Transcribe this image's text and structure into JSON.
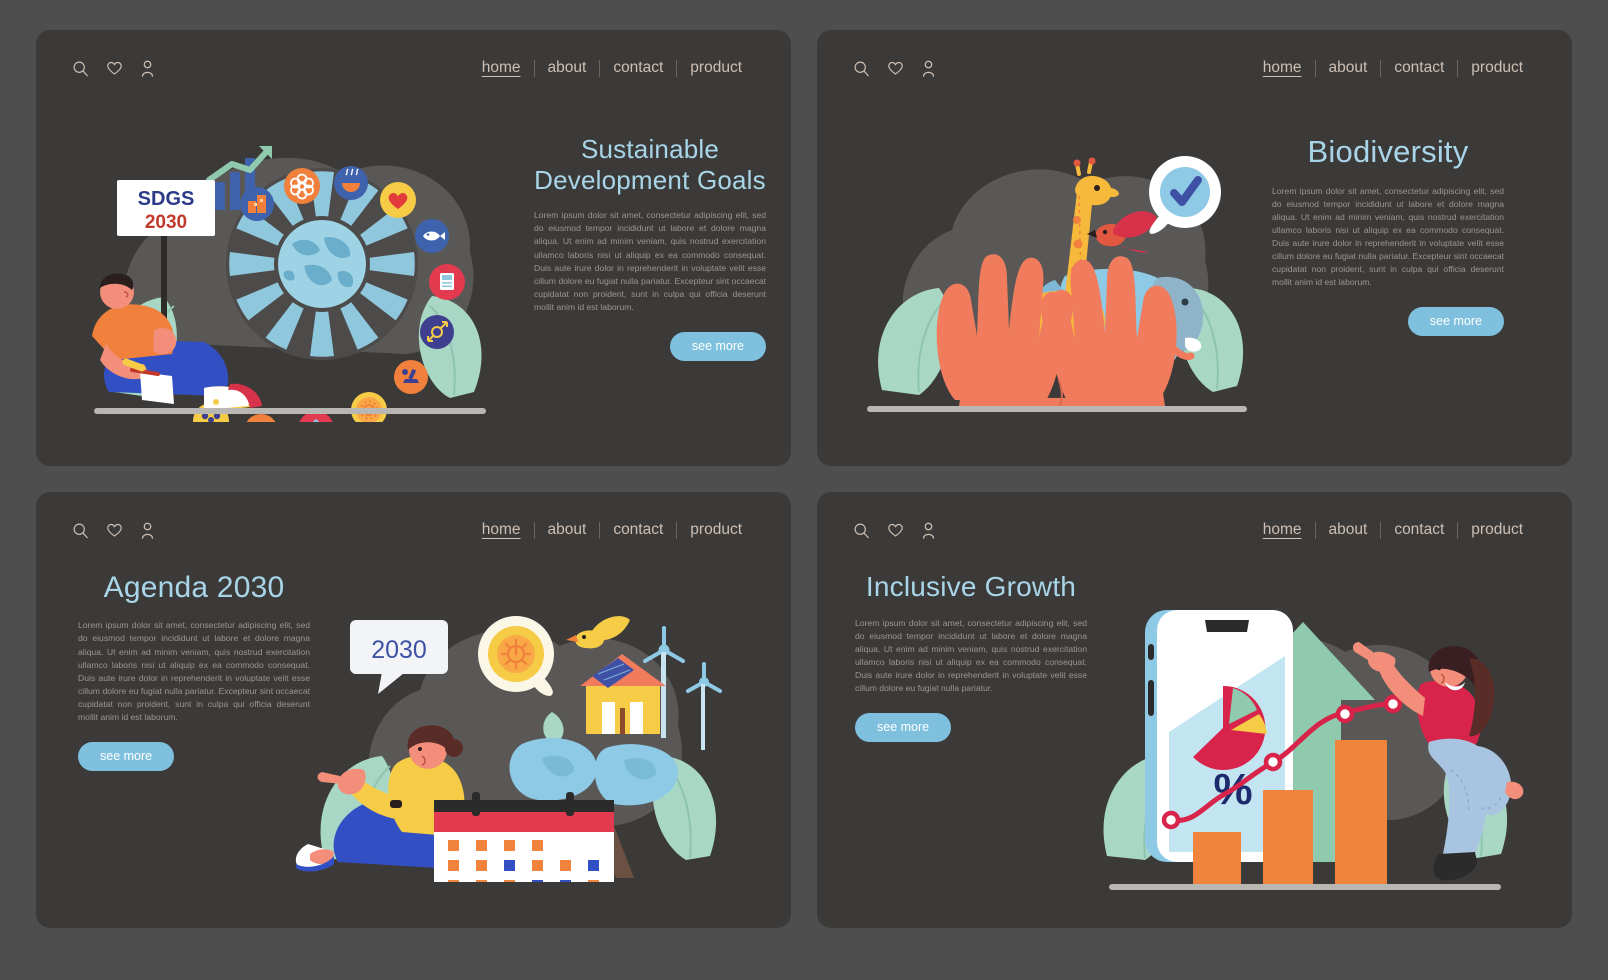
{
  "theme": {
    "page_bg": "#4e4e4e",
    "card_bg": "#3c3a39",
    "title_color": "#a8d6e8",
    "body_color": "#9d958e",
    "nav_color": "#cdbfb3",
    "button_bg": "#7fc0de",
    "button_text": "#ffffff"
  },
  "nav": {
    "icons": [
      {
        "name": "search-icon"
      },
      {
        "name": "heart-icon"
      },
      {
        "name": "user-icon"
      }
    ],
    "links": [
      {
        "label": "home",
        "active": true
      },
      {
        "label": "about",
        "active": false
      },
      {
        "label": "contact",
        "active": false
      },
      {
        "label": "product",
        "active": false
      }
    ]
  },
  "common": {
    "see_more": "see more",
    "lorem_long": "Lorem ipsum dolor sit amet, consectetur adipiscing elit, sed do eiusmod tempor incididunt ut labore et dolore magna aliqua. Ut enim ad minim veniam, quis nostrud exercitation ullamco laboris nisi ut aliquip ex ea commodo consequat. Duis aute irure dolor in reprehenderit in voluptate velit esse cillum dolore eu fugiat nulla pariatur. Excepteur sint occaecat cupidatat non proident, sunt in culpa qui officia deserunt mollit anim id est laborum.",
    "lorem_short": "Lorem ipsum dolor sit amet, consectetur adipiscing elit, sed do eiusmod tempor incididunt ut labore et dolore magna aliqua. Ut enim ad minim veniam, quis nostrud exercitation ullamco laboris nisi ut aliquip ex ea commodo consequat. Duis aute irure dolor in reprehenderit in voluptate velit esse cillum dolore eu fugiat nulla pariatur."
  },
  "cards": [
    {
      "id": "sustainable-development-goals",
      "title": "Sustainable Development Goals",
      "sign_top": "SDGS",
      "sign_bottom": "2030",
      "illustration": "sdg-wheel-person-sign",
      "icons": [
        {
          "name": "city-house-icon",
          "bg": "#3f62ad",
          "fg": "#f0803c"
        },
        {
          "name": "flower-partnership-icon",
          "bg": "#f0803c",
          "fg": "#ffffff"
        },
        {
          "name": "food-bowl-icon",
          "bg": "#3f62ad",
          "fg": "#f0803c"
        },
        {
          "name": "health-heart-icon",
          "bg": "#f6cc46",
          "fg": "#e23b3b"
        },
        {
          "name": "fish-life-below-water-icon",
          "bg": "#3f62ad",
          "fg": "#ffffff"
        },
        {
          "name": "education-book-icon",
          "bg": "#e23b4f",
          "fg": "#8fc7dd"
        },
        {
          "name": "gender-equality-icon",
          "bg": "#3f3f8f",
          "fg": "#f6cc46"
        },
        {
          "name": "industry-innovation-icon",
          "bg": "#f0803c",
          "fg": "#3f3f8f"
        },
        {
          "name": "clean-energy-sun-icon",
          "bg": "#f6cc46",
          "fg": "#f0803c"
        },
        {
          "name": "life-on-land-tree-icon",
          "bg": "#e23b4f",
          "fg": "#8fc7dd"
        },
        {
          "name": "clean-water-drop-icon",
          "bg": "#f0803c",
          "fg": "#ffffff"
        },
        {
          "name": "reduced-inequalities-people-icon",
          "bg": "#f6cc46",
          "fg": "#3f3f8f"
        }
      ]
    },
    {
      "id": "biodiversity",
      "title": "Biodiversity",
      "illustration": "hands-holding-animals",
      "elements": [
        {
          "name": "giraffe",
          "color": "#f6b93b"
        },
        {
          "name": "elephant",
          "color": "#8ecae6"
        },
        {
          "name": "bird",
          "color": "#e2573f"
        },
        {
          "name": "check-badge",
          "color": "#3f51a5"
        },
        {
          "name": "hands",
          "color": "#f07b5d"
        }
      ]
    },
    {
      "id": "agenda-2030",
      "title": "Agenda 2030",
      "bubble_label": "2030",
      "illustration": "woman-calendar-eco-city",
      "elements": [
        {
          "name": "sun-power-icon",
          "color": "#f6cc46"
        },
        {
          "name": "bird",
          "color": "#f6cc46"
        },
        {
          "name": "wind-turbine",
          "color": "#8ecae6"
        },
        {
          "name": "solar-house",
          "color": "#f6a944"
        },
        {
          "name": "calendar",
          "color": "#e23b4f"
        }
      ]
    },
    {
      "id": "inclusive-growth",
      "title": "Inclusive Growth",
      "percent_label": "%",
      "illustration": "phone-chart-growth-woman",
      "elements": [
        {
          "name": "pie-chart",
          "color": "#d8244a"
        },
        {
          "name": "bar-chart",
          "color": "#f0843c"
        },
        {
          "name": "line-chart",
          "color": "#d8244a"
        },
        {
          "name": "up-arrow",
          "color": "#8fc9ae"
        },
        {
          "name": "smartphone",
          "color": "#8ecae6"
        }
      ]
    }
  ]
}
